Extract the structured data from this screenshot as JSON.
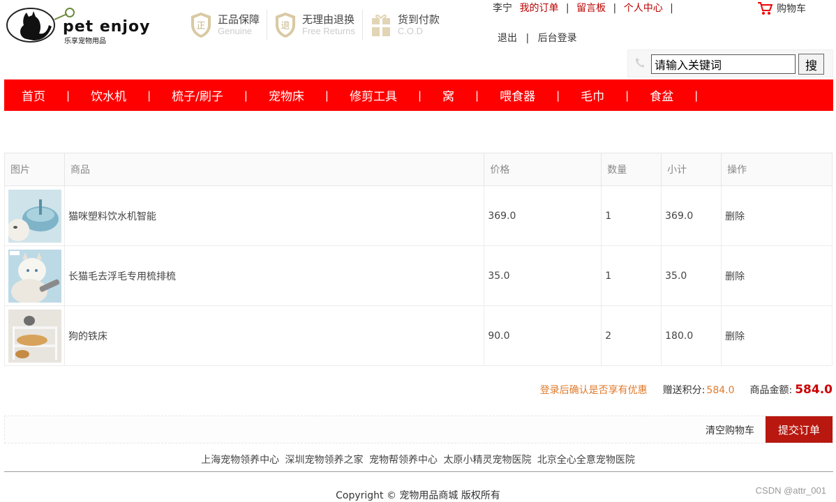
{
  "logo": {
    "brand": "pet enjoy",
    "tagline": "乐享宠物用品"
  },
  "guarantees": [
    {
      "main": "正品保障",
      "sub": "Genuine",
      "icon": "正"
    },
    {
      "main": "无理由退换",
      "sub": "Free Returns",
      "icon": "退"
    },
    {
      "main": "货到付款",
      "sub": "C.O.D",
      "icon": "gift"
    }
  ],
  "user_nav": {
    "username": "李宁",
    "my_orders": "我的订单",
    "message_board": "留言板",
    "personal_center": "个人中心",
    "logout": "退出",
    "admin_login": "后台登录",
    "cart": "购物车"
  },
  "search": {
    "value": "请输入关键词",
    "button": "搜"
  },
  "nav": [
    "首页",
    "饮水机",
    "梳子/刷子",
    "宠物床",
    "修剪工具",
    "窝",
    "喂食器",
    "毛巾",
    "食盆"
  ],
  "table": {
    "headers": [
      "图片",
      "商品",
      "价格",
      "数量",
      "小计",
      "操作"
    ],
    "rows": [
      {
        "name": "猫咪塑料饮水机智能",
        "price": "369.0",
        "qty": "1",
        "subtotal": "369.0",
        "action": "删除"
      },
      {
        "name": "长猫毛去浮毛专用梳排梳",
        "price": "35.0",
        "qty": "1",
        "subtotal": "35.0",
        "action": "删除"
      },
      {
        "name": "狗的铁床",
        "price": "90.0",
        "qty": "2",
        "subtotal": "180.0",
        "action": "删除"
      }
    ]
  },
  "summary": {
    "promo": "登录后确认是否享有优惠",
    "points_label": "赠送积分:",
    "points": "584.0",
    "total_label": "商品金额:",
    "total": "584.0"
  },
  "actions": {
    "clear": "清空购物车",
    "submit": "提交订单"
  },
  "footer": {
    "links": [
      "上海宠物领养中心",
      "深圳宠物领养之家",
      "宠物帮领养中心",
      "太原小精灵宠物医院",
      "北京全心全意宠物医院"
    ],
    "copyright": "Copyright © 宠物用品商城 版权所有",
    "watermark": "CSDN @attr_001"
  }
}
